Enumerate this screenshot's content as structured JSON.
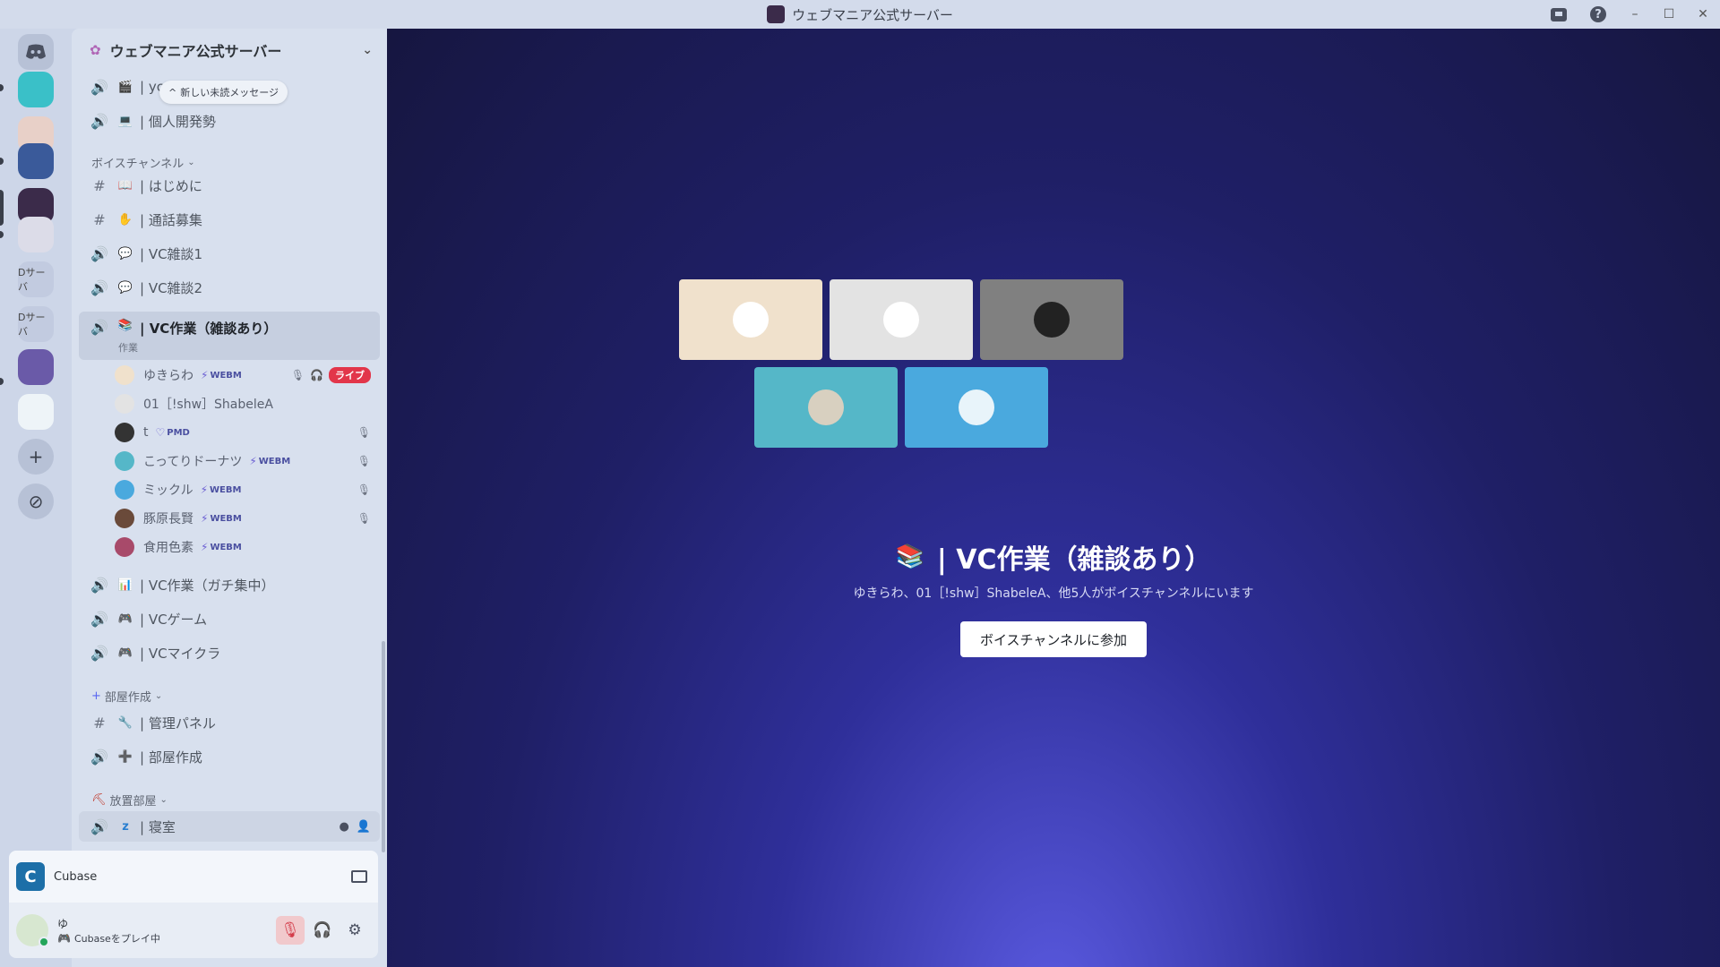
{
  "window": {
    "title": "ウェブマニア公式サーバー"
  },
  "rail": {
    "text_servers": [
      "Dサーバ",
      "Dサーバ"
    ]
  },
  "server": {
    "name": "ウェブマニア公式サーバー"
  },
  "unread_pill": {
    "arrow": "^",
    "label": "新しい未読メッセージ"
  },
  "channels_top": [
    {
      "type": "voice",
      "emoji": "🎬",
      "name": "| yc"
    },
    {
      "type": "voice",
      "emoji": "💻",
      "name": "| 個人開発勢"
    }
  ],
  "category_voice": {
    "label": "ボイスチャンネル"
  },
  "voice_channels": [
    {
      "type": "text",
      "emoji": "📖",
      "name": "| はじめに"
    },
    {
      "type": "text",
      "emoji": "✋",
      "name": "| 通話募集"
    },
    {
      "type": "voice",
      "emoji": "💬",
      "name": "| VC雑談1"
    },
    {
      "type": "voice",
      "emoji": "💬",
      "name": "| VC雑談2"
    }
  ],
  "active_channel": {
    "emoji": "📚",
    "name": "| VC作業（雑談あり）",
    "sub": "作業"
  },
  "members": [
    {
      "name": "ゆきらわ",
      "badge": "WEBM",
      "live": "ライブ"
    },
    {
      "name": "01［!shw］ShabeleA",
      "badge": ""
    },
    {
      "name": "t",
      "badge": "PMD"
    },
    {
      "name": "こってりドーナツ",
      "badge": "WEBM"
    },
    {
      "name": "ミックル",
      "badge": "WEBM"
    },
    {
      "name": "豚原長賢",
      "badge": "WEBM"
    },
    {
      "name": "食用色素",
      "badge": "WEBM"
    }
  ],
  "voice_channels_2": [
    {
      "type": "voice",
      "emoji": "📊",
      "name": "| VC作業（ガチ集中）"
    },
    {
      "type": "voice",
      "emoji": "🎮",
      "name": "| VCゲーム"
    },
    {
      "type": "voice",
      "emoji": "🎮",
      "name": "| VCマイクラ"
    }
  ],
  "category_rooms": {
    "label": "部屋作成"
  },
  "room_channels": [
    {
      "type": "text",
      "emoji": "🔧",
      "name": "| 管理パネル"
    },
    {
      "type": "voice",
      "emoji": "➕",
      "name": "| 部屋作成"
    }
  ],
  "category_afk": {
    "label": "放置部屋"
  },
  "afk_channels": [
    {
      "type": "voice",
      "emoji": "z",
      "name": "| 寝室"
    }
  ],
  "activity": {
    "name": "Cubase"
  },
  "user": {
    "name": "ゆ",
    "status": "Cubaseをプレイ中"
  },
  "stage": {
    "title_emoji": "📚",
    "title": "| VC作業（雑談あり）",
    "subtitle": "ゆきらわ、01［!shw］ShabeleA、他5人がボイスチャンネルにいます",
    "join_label": "ボイスチャンネルに参加",
    "tile_colors": [
      "#f0e1cc",
      "#e3e3e3",
      "#808080",
      "#55b7c8",
      "#4aa9de"
    ]
  },
  "colors": {
    "accent": "#5865f2",
    "live": "#e2364a",
    "online": "#23a55a"
  }
}
